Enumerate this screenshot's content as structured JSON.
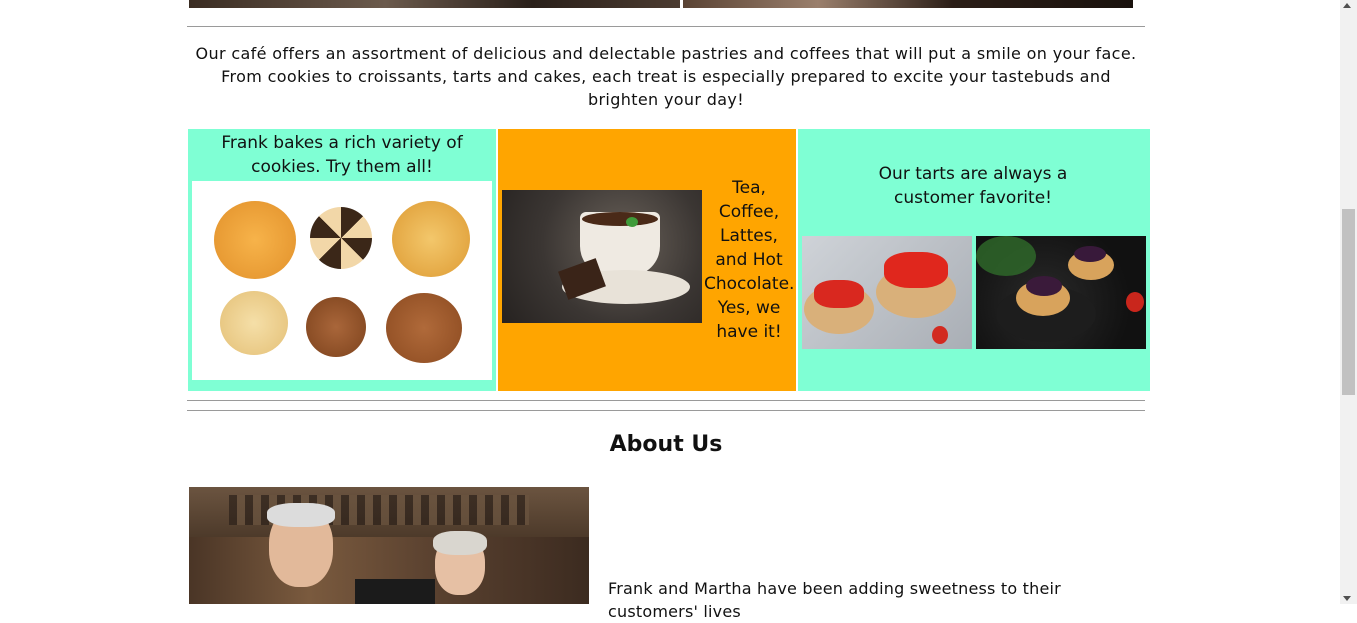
{
  "intro": {
    "text": "Our café offers an assortment of delicious and delectable pastries and coffees that will put a smile on your face. From cookies to croissants, tarts and cakes, each treat is especially prepared to excite your tastebuds and brighten your day!"
  },
  "panels": [
    {
      "text": "Frank bakes a rich variety of cookies. Try them all!",
      "image": "cookies-photo",
      "color": "#7fffd4"
    },
    {
      "text": "Tea, Coffee, Lattes, and Hot Chocolate. Yes, we have it!",
      "image": "hot-chocolate-photo",
      "color": "#ffa500"
    },
    {
      "text": "Our tarts are always a customer favorite!",
      "image": "tarts-photos",
      "color": "#7fffd4"
    }
  ],
  "about": {
    "title": "About Us",
    "text": "Frank and Martha have been adding sweetness to their customers' lives"
  }
}
